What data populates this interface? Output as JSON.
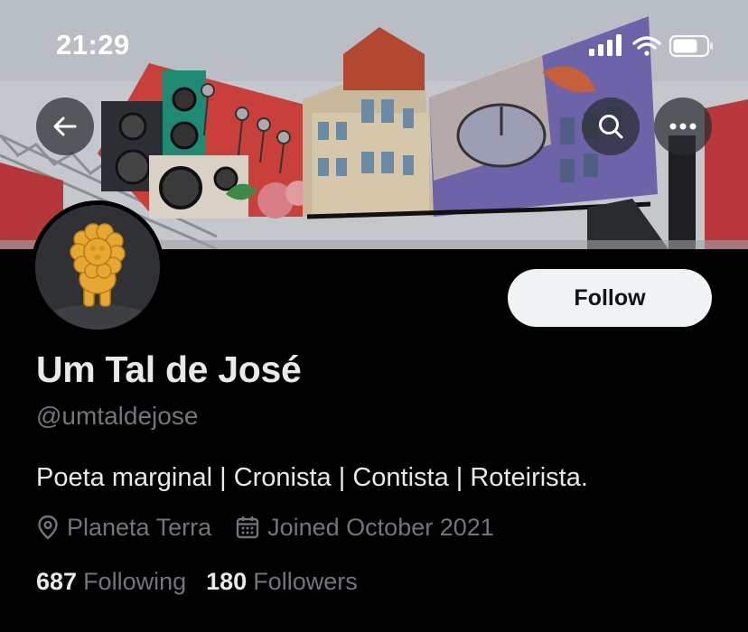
{
  "status_bar": {
    "time": "21:29",
    "signal_icon": "cellular-signal-icon",
    "wifi_icon": "wifi-icon",
    "battery_icon": "battery-icon"
  },
  "header": {
    "back_icon": "arrow-left-icon",
    "search_icon": "search-icon",
    "more_icon": "ellipsis-icon"
  },
  "profile": {
    "display_name": "Um Tal de José",
    "handle": "@umtaldejose",
    "bio": "Poeta marginal | Cronista | Contista | Roteirista.",
    "location": "Planeta Terra",
    "location_icon": "location-pin-icon",
    "joined": "Joined October 2021",
    "joined_icon": "calendar-icon",
    "following_count": "687",
    "following_label": "Following",
    "followers_count": "180",
    "followers_label": "Followers"
  },
  "actions": {
    "follow_label": "Follow"
  },
  "colors": {
    "background": "#000000",
    "primary_text": "#e7e9ea",
    "secondary_text": "#71767b",
    "follow_button_bg": "#eff3f4",
    "follow_button_text": "#0f1419"
  }
}
